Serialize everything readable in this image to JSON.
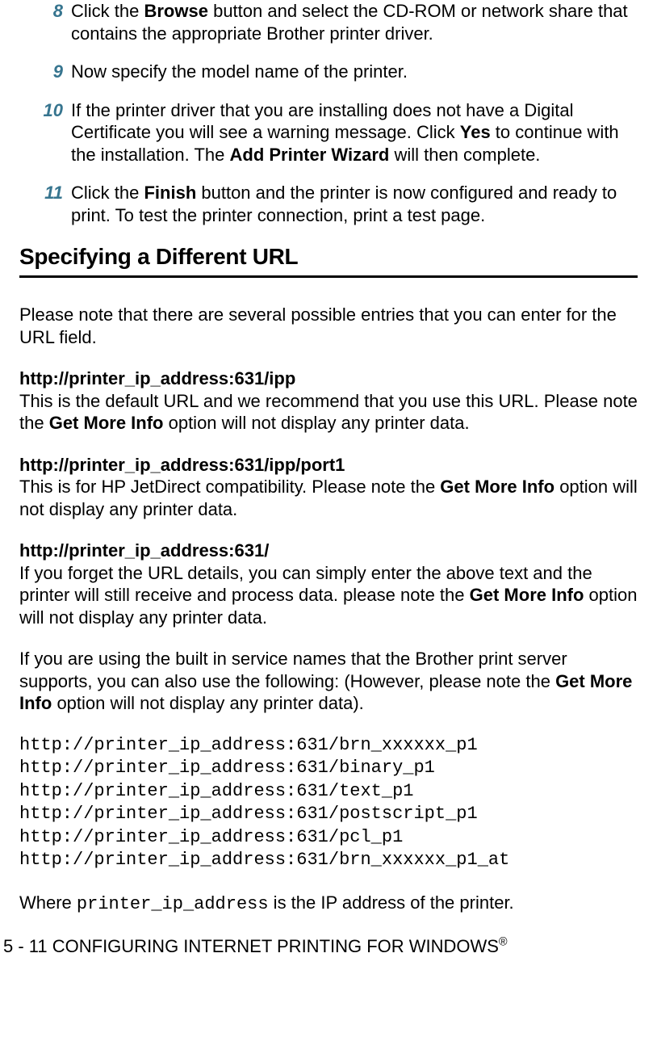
{
  "steps": [
    {
      "num": "8",
      "html": "Click the <b>Browse</b> button and select the CD-ROM or network share that contains the appropriate Brother printer driver."
    },
    {
      "num": "9",
      "html": "Now specify the model name of the printer."
    },
    {
      "num": "10",
      "html": "If the printer driver that you are installing does not have a Digital Certificate you will see a warning message. Click <b>Yes</b> to continue with the installation. The <b>Add Printer Wizard</b> will then complete."
    },
    {
      "num": "11",
      "html": "Click the <b>Finish</b> button and the printer is now configured and ready to print. To test the printer connection, print a test page."
    }
  ],
  "heading": "Specifying a Different URL",
  "intro": "Please note that there are several possible entries that you can enter for the URL field.",
  "urls": [
    {
      "title": "http://printer_ip_address:631/ipp",
      "desc": "This is the default URL and we recommend that you use this URL. Please note the <b>Get More Info</b> option will not display any printer data."
    },
    {
      "title": "http://printer_ip_address:631/ipp/port1",
      "desc": "This is for HP JetDirect compatibility. Please note the <b>Get More Info</b> option will not display any printer data."
    },
    {
      "title": "http://printer_ip_address:631/",
      "desc": "If you forget the URL details, you can simply enter the above text and the printer will still receive and process data. please note the <b>Get More Info</b> option will not display any printer data."
    }
  ],
  "builtin_note": "If you are using the built in service names that the Brother print server supports, you can also use the following: (However, please note the <b>Get More Info</b> option will not display any printer data).",
  "code_lines": [
    "http://printer_ip_address:631/brn_xxxxxx_p1",
    "http://printer_ip_address:631/binary_p1",
    "http://printer_ip_address:631/text_p1",
    "http://printer_ip_address:631/postscript_p1",
    "http://printer_ip_address:631/pcl_p1",
    "http://printer_ip_address:631/brn_xxxxxx_p1_at"
  ],
  "where_prefix": "Where ",
  "where_code": "printer_ip_address",
  "where_suffix": " is the IP address of the printer.",
  "footer_main": "5 - 11 CONFIGURING INTERNET PRINTING FOR WINDOWS",
  "footer_sup": "®"
}
